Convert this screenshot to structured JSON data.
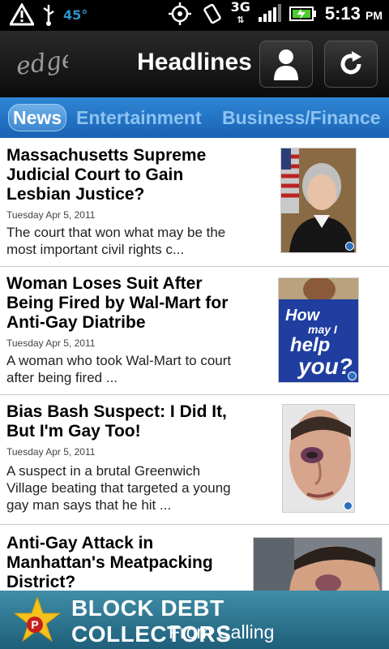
{
  "status_bar": {
    "temperature": "45°",
    "network": "3G",
    "time": "5:13",
    "ampm": "PM",
    "icons": [
      "warning-icon",
      "usb-icon",
      "gps-icon",
      "vibrate-icon",
      "signal-icon",
      "battery-icon"
    ]
  },
  "app_bar": {
    "logo_text": "edge",
    "title": "Headlines"
  },
  "tabs": [
    {
      "label": "News",
      "active": true
    },
    {
      "label": "Entertainment",
      "active": false
    },
    {
      "label": "Business/Finance",
      "active": false
    }
  ],
  "articles": [
    {
      "headline": "Massachusetts Supreme Judicial Court to Gain Lesbian Justice?",
      "date": "Tuesday Apr 5, 2011",
      "summary": "The court that won what may be the most important civil rights c..."
    },
    {
      "headline": "Woman Loses Suit After Being Fired by Wal-Mart for Anti-Gay Diatribe",
      "date": "Tuesday Apr 5, 2011",
      "summary": "A woman who took Wal-Mart to court after being fired ...",
      "image_text": [
        "How",
        "may I",
        "help",
        "you?"
      ]
    },
    {
      "headline": "Bias Bash Suspect: I Did It, But I'm Gay Too!",
      "date": "Tuesday Apr 5, 2011",
      "summary": "A suspect in a brutal Greenwich Village beating that targeted a young gay man says that he hit ..."
    },
    {
      "headline": "Anti-Gay Attack in Manhattan's Meatpacking District?",
      "date": "",
      "summary": ""
    }
  ],
  "ad": {
    "line1": "BLOCK DEBT COLLECTORS",
    "line2": "From Calling",
    "badge": "P"
  },
  "colors": {
    "tab_bar": "#1a62b3",
    "status_temp": "#2e93c8",
    "ad_bg": "#2a7390"
  }
}
